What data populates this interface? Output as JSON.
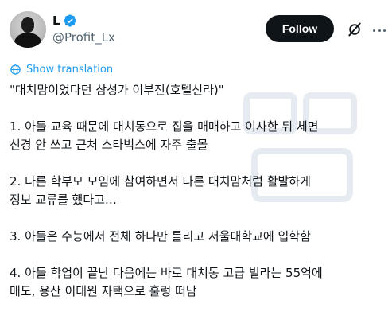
{
  "user": {
    "display_name": "L",
    "handle": "@Profit_Lx",
    "verified": true
  },
  "actions": {
    "follow_label": "Follow",
    "grok_icon": "grok-icon",
    "more_icon": "more-dots-icon"
  },
  "translation": {
    "label": "Show translation"
  },
  "post": {
    "title": "\"대치맘이었다던 삼성가 이부진(호텔신라)\"",
    "items": [
      "1. 아들 교육 때문에 대치동으로 집을 매매하고 이사한 뒤 체면\n신경 안 쓰고 근처 스타벅스에 자주 출몰",
      "2. 다른 학부모 모임에 참여하면서 다른 대치맘처럼 활발하게\n정보 교류를 했다고…",
      "3. 아들은 수능에서 전체 하나만 틀리고 서울대학교에 입학함",
      "4. 아들 학업이 끝난 다음에는 바로 대치동 고급 빌라는 55억에\n매도, 용산 이태원 자택으로 훌렁 떠남"
    ]
  },
  "colors": {
    "text": "#0f1419",
    "secondary": "#536471",
    "link": "#1d9bf0",
    "verified": "#1d9bf0",
    "button_bg": "#0f1419"
  }
}
